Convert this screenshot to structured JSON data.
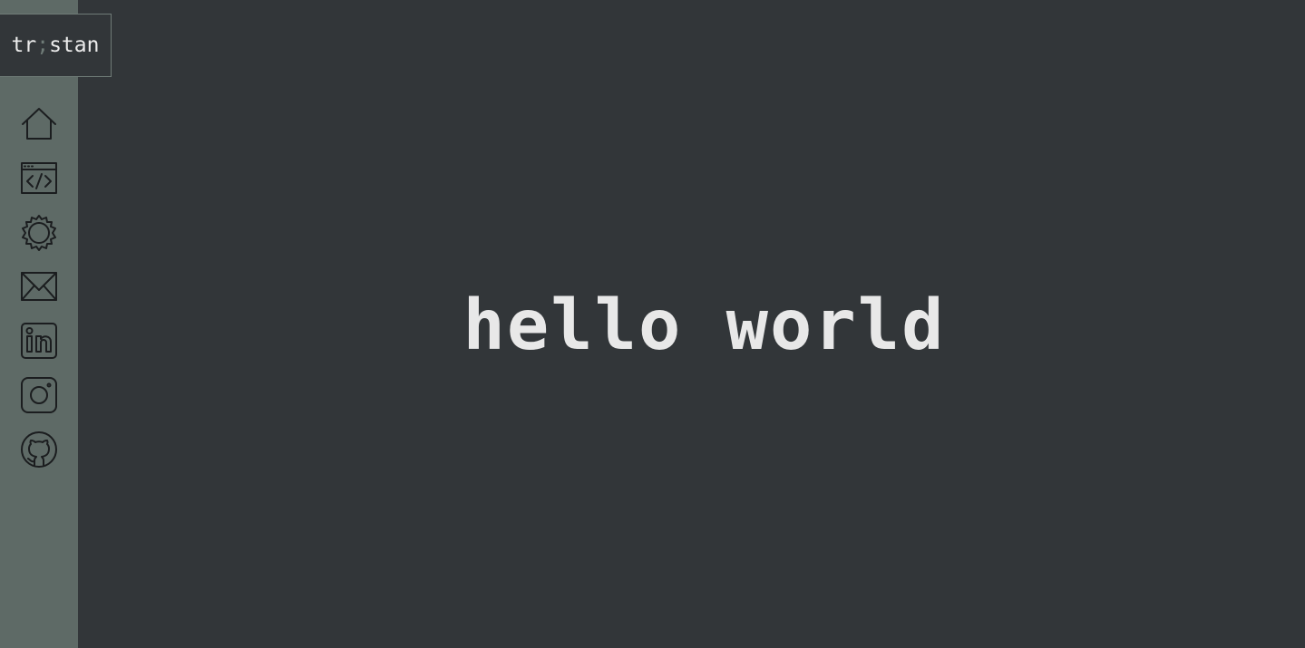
{
  "logo": {
    "prefix": "tr",
    "separator": ";",
    "suffix": "stan"
  },
  "nav": [
    {
      "icon": "home-icon"
    },
    {
      "icon": "code-window-icon"
    },
    {
      "icon": "gear-icon"
    },
    {
      "icon": "mail-icon"
    },
    {
      "icon": "linkedin-icon"
    },
    {
      "icon": "instagram-icon"
    },
    {
      "icon": "github-icon"
    }
  ],
  "hero": {
    "text": "hello world"
  },
  "colors": {
    "background": "#323639",
    "sidebar": "#5e6a66",
    "text": "#e8e8e8",
    "icon_stroke": "#1b1d1f"
  }
}
